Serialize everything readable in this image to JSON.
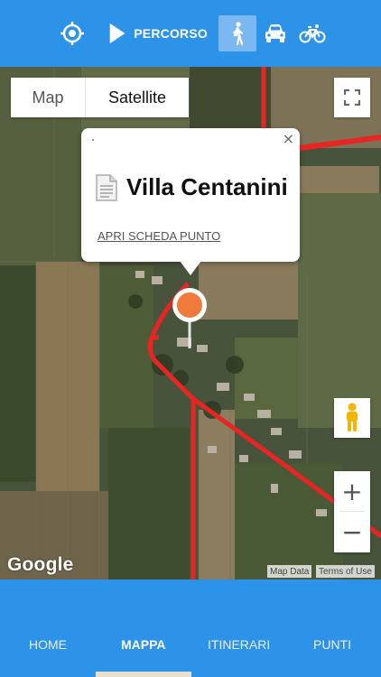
{
  "toolbar": {
    "locate_icon": "crosshair-icon",
    "route_icon": "play-icon",
    "route_label": "PERCORSO",
    "modes": [
      {
        "icon": "walk-icon",
        "selected": true
      },
      {
        "icon": "car-icon",
        "selected": false
      },
      {
        "icon": "bike-icon",
        "selected": false
      }
    ]
  },
  "map": {
    "type_buttons": {
      "map": "Map",
      "satellite": "Satellite"
    },
    "selected_type": "Satellite",
    "popup": {
      "title": "Villa Centanini",
      "link": "APRI SCHEDA PUNTO",
      "close": "×"
    },
    "zoom": {
      "in": "+",
      "out": "−"
    },
    "logo": "Google",
    "attribution": {
      "data": "Map Data",
      "terms": "Terms of Use"
    }
  },
  "bottom_nav": {
    "items": [
      "HOME",
      "MAPPA",
      "ITINERARI",
      "PUNTI"
    ],
    "active": "MAPPA"
  },
  "colors": {
    "brand": "#2d93e8",
    "route": "#e82525",
    "marker": "#f07a3a"
  }
}
